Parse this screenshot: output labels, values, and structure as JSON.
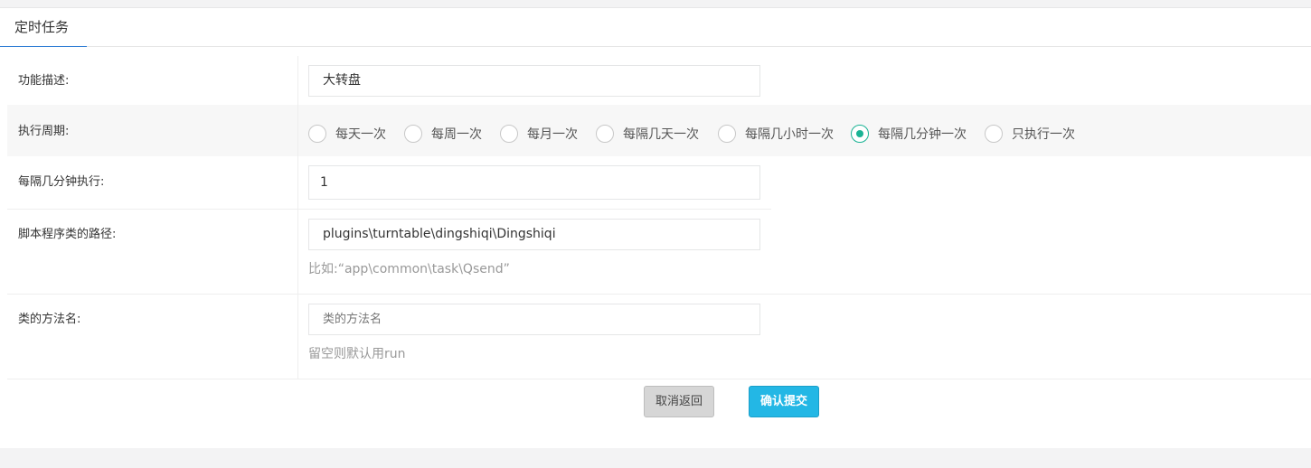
{
  "tabs": [
    {
      "label": "定时任务"
    }
  ],
  "form": {
    "description": {
      "label": "功能描述:",
      "value": "大转盘"
    },
    "period": {
      "label": "执行周期:",
      "options": [
        "每天一次",
        "每周一次",
        "每月一次",
        "每隔几天一次",
        "每隔几小时一次",
        "每隔几分钟一次",
        "只执行一次"
      ],
      "selected": "每隔几分钟一次"
    },
    "interval": {
      "label": "每隔几分钟执行:",
      "value": "1"
    },
    "path": {
      "label": "脚本程序类的路径:",
      "value": "plugins\\turntable\\dingshiqi\\Dingshiqi",
      "help": "比如:“app\\common\\task\\Qsend”"
    },
    "method": {
      "label": "类的方法名:",
      "placeholder": "类的方法名",
      "help": "留空则默认用run"
    }
  },
  "buttons": {
    "cancel": "取消返回",
    "submit": "确认提交"
  },
  "colors": {
    "accent": "#1ab394",
    "tab_underline": "#2b7bd4",
    "submit": "#23b7e5"
  }
}
